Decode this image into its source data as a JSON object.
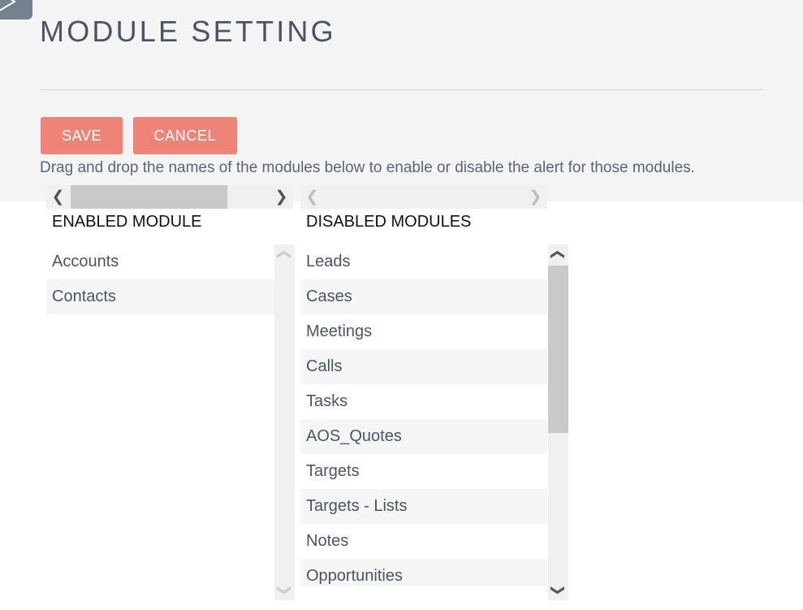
{
  "header": {
    "title": "MODULE SETTING",
    "back_icon": "back-arrow-icon"
  },
  "toolbar": {
    "save_label": "SAVE",
    "cancel_label": "CANCEL",
    "button_color": "#ee8377"
  },
  "instructions": {
    "text": "Drag and drop the names of the modules below to enable or disable the alert for those modules."
  },
  "panels": {
    "enabled": {
      "header": "ENABLED MODULE",
      "items": [
        "Accounts",
        "Contacts"
      ],
      "vscroll": {
        "up_icon": "chevron-up-icon",
        "down_icon": "chevron-down-icon",
        "enabled": false
      },
      "hscroll": {
        "left_icon": "chevron-left-icon",
        "right_icon": "chevron-right-icon",
        "enabled": true
      }
    },
    "disabled": {
      "header": "DISABLED MODULES",
      "items": [
        "Leads",
        "Cases",
        "Meetings",
        "Calls",
        "Tasks",
        "AOS_Quotes",
        "Targets",
        "Targets - Lists",
        "Notes",
        "Opportunities"
      ],
      "vscroll": {
        "up_icon": "chevron-up-icon",
        "down_icon": "chevron-down-icon",
        "enabled": true
      },
      "hscroll": {
        "left_icon": "chevron-left-icon",
        "right_icon": "chevron-right-icon",
        "enabled": false
      }
    }
  },
  "colors": {
    "page_background": "#ffffff",
    "band_background": "#f4f4f4",
    "text": "#4c5468",
    "title": "#4c5464",
    "row_alt": "#f5f5f5",
    "scroll_track": "#f0f0f0",
    "scroll_thumb": "#c9c9c9"
  }
}
